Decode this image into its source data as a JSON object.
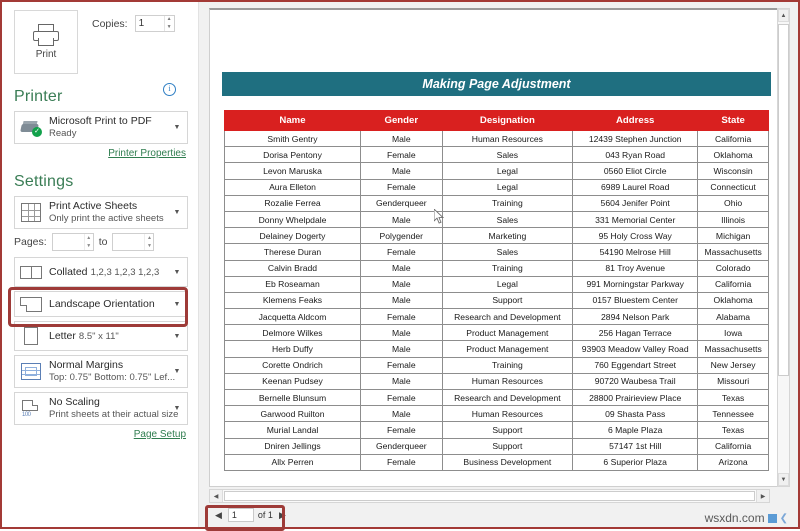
{
  "settings_pane": {
    "print_button": {
      "label": "Print",
      "icon": "printer-icon"
    },
    "copies": {
      "label": "Copies:",
      "value": "1"
    },
    "printer_section": {
      "heading": "Printer",
      "info_icon": "i",
      "selected": {
        "name": "Microsoft Print to PDF",
        "status": "Ready"
      },
      "properties_link": "Printer Properties"
    },
    "settings_section": {
      "heading": "Settings",
      "print_what": {
        "title": "Print Active Sheets",
        "subtitle": "Only print the active sheets"
      },
      "pages": {
        "label": "Pages:",
        "from": "",
        "to_label": "to",
        "to": ""
      },
      "collation": {
        "title": "Collated",
        "subtitle": "1,2,3   1,2,3   1,2,3"
      },
      "orientation": {
        "title": "Landscape Orientation",
        "subtitle": "",
        "highlighted": true
      },
      "paper_size": {
        "title": "Letter",
        "subtitle": "8.5\" x 11\""
      },
      "margins": {
        "title": "Normal Margins",
        "subtitle": "Top: 0.75\" Bottom: 0.75\" Lef..."
      },
      "scaling": {
        "title": "No Scaling",
        "subtitle": "Print sheets at their actual size"
      },
      "page_setup_link": "Page Setup"
    }
  },
  "preview": {
    "document_title": "Making Page Adjustment",
    "table": {
      "columns": [
        "Name",
        "Gender",
        "Designation",
        "Address",
        "State"
      ],
      "rows": [
        [
          "Smith Gentry",
          "Male",
          "Human Resources",
          "12439 Stephen Junction",
          "California"
        ],
        [
          "Dorisa Pentony",
          "Female",
          "Sales",
          "043 Ryan Road",
          "Oklahoma"
        ],
        [
          "Levon Maruska",
          "Male",
          "Legal",
          "0560 Eliot Circle",
          "Wisconsin"
        ],
        [
          "Aura Elleton",
          "Female",
          "Legal",
          "6989 Laurel Road",
          "Connecticut"
        ],
        [
          "Rozalie Ferrea",
          "Genderqueer",
          "Training",
          "5604 Jenifer Point",
          "Ohio"
        ],
        [
          "Donny Whelpdale",
          "Male",
          "Sales",
          "331 Memorial Center",
          "Illinois"
        ],
        [
          "Delainey Dogerty",
          "Polygender",
          "Marketing",
          "95 Holy Cross Way",
          "Michigan"
        ],
        [
          "Therese Duran",
          "Female",
          "Sales",
          "54190 Melrose Hill",
          "Massachusetts"
        ],
        [
          "Calvin Bradd",
          "Male",
          "Training",
          "81 Troy Avenue",
          "Colorado"
        ],
        [
          "Eb Roseaman",
          "Male",
          "Legal",
          "991 Morningstar Parkway",
          "California"
        ],
        [
          "Klemens Feaks",
          "Male",
          "Support",
          "0157 Bluestem Center",
          "Oklahoma"
        ],
        [
          "Jacquetta Aldcom",
          "Female",
          "Research and Development",
          "2894 Nelson Park",
          "Alabama"
        ],
        [
          "Delmore Wilkes",
          "Male",
          "Product Management",
          "256 Hagan Terrace",
          "Iowa"
        ],
        [
          "Herb Duffy",
          "Male",
          "Product Management",
          "93903 Meadow Valley Road",
          "Massachusetts"
        ],
        [
          "Corette Ondrich",
          "Female",
          "Training",
          "760 Eggendart Street",
          "New Jersey"
        ],
        [
          "Keenan Pudsey",
          "Male",
          "Human Resources",
          "90720 Waubesa Trail",
          "Missouri"
        ],
        [
          "Bernelle Blunsum",
          "Female",
          "Research and Development",
          "28800 Prairieview Place",
          "Texas"
        ],
        [
          "Garwood Ruilton",
          "Male",
          "Human Resources",
          "09 Shasta Pass",
          "Tennessee"
        ],
        [
          "Murial Landal",
          "Female",
          "Support",
          "6 Maple Plaza",
          "Texas"
        ],
        [
          "Dniren Jellings",
          "Genderqueer",
          "Support",
          "57147 1st Hill",
          "California"
        ],
        [
          "Allx Perren",
          "Female",
          "Business Development",
          "6 Superior Plaza",
          "Arizona"
        ]
      ]
    }
  },
  "pager": {
    "prev_icon": "◀",
    "page_value": "1",
    "of_label": "of 1",
    "next_icon": "▶",
    "highlighted": true
  },
  "watermark": {
    "text": "wsxdn.com"
  },
  "colors": {
    "title_bar": "#1f6f80",
    "table_header": "#d9201f",
    "highlight_border": "#9e3b38",
    "section_heading": "#3a7d55",
    "link": "#2f7d4f",
    "frame_border": "#a33a36"
  }
}
